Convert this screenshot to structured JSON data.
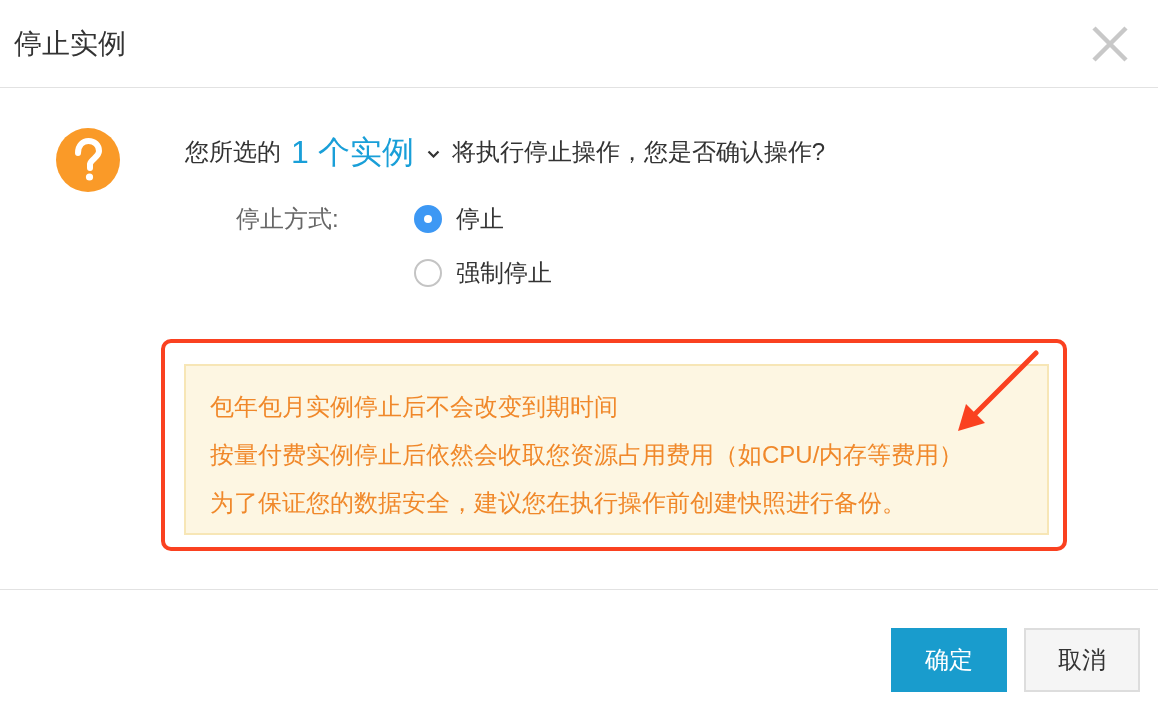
{
  "dialog": {
    "title": "停止实例"
  },
  "prompt": {
    "before": "您所选的",
    "selection": "1 个实例",
    "after": "将执行停止操作，您是否确认操作?"
  },
  "stop_mode": {
    "label": "停止方式:",
    "options": [
      {
        "label": "停止",
        "selected": true
      },
      {
        "label": "强制停止",
        "selected": false
      }
    ]
  },
  "notice": {
    "lines": [
      "包年包月实例停止后不会改变到期时间",
      "按量付费实例停止后依然会收取您资源占用费用（如CPU/内存等费用）",
      "为了保证您的数据安全，建议您在执行操作前创建快照进行备份。"
    ]
  },
  "buttons": [
    {
      "label": "确定",
      "kind": "primary"
    },
    {
      "label": "取消",
      "kind": "secondary"
    }
  ]
}
